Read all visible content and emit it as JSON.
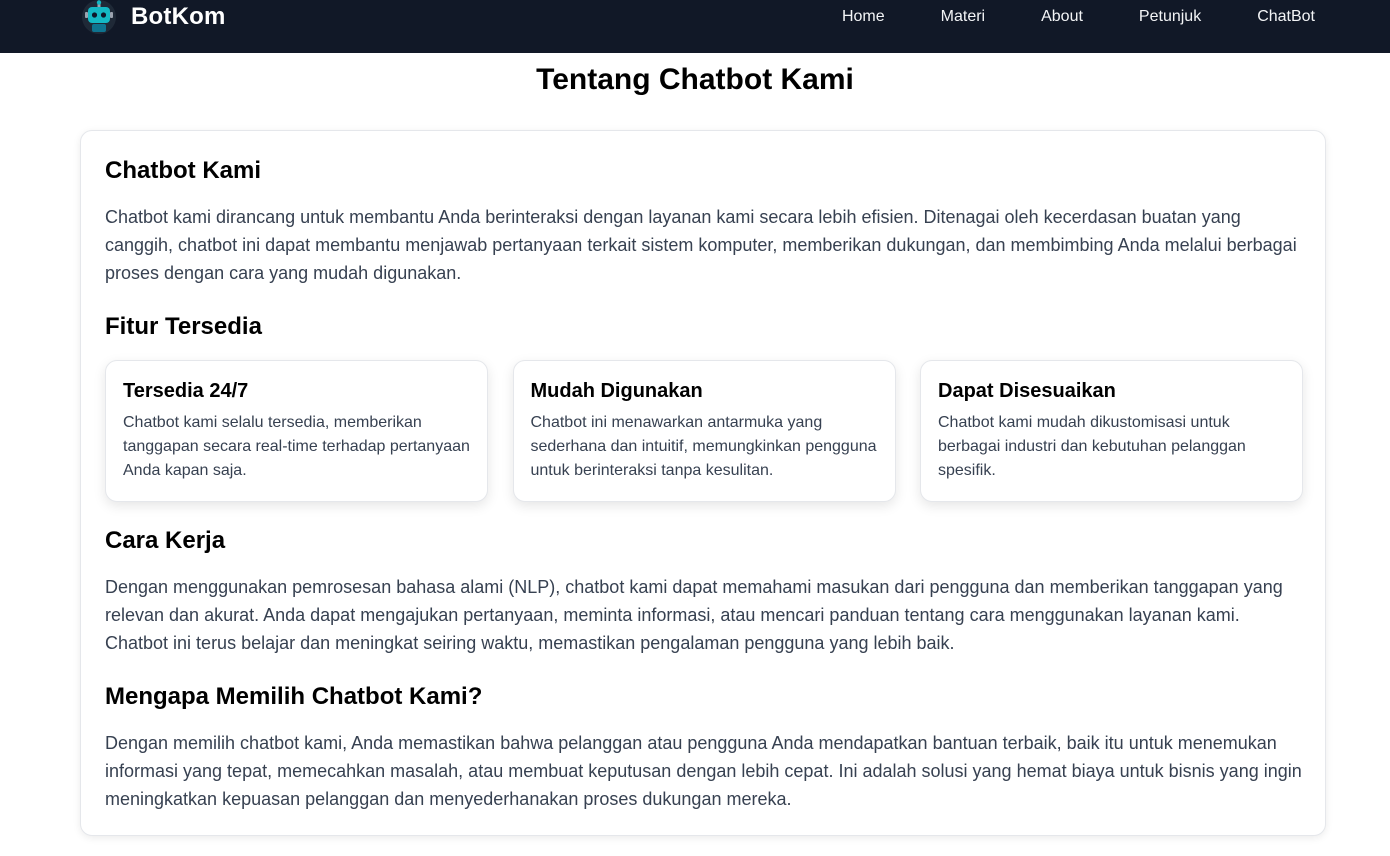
{
  "nav": {
    "brand": "BotKom",
    "links": [
      "Home",
      "Materi",
      "About",
      "Petunjuk",
      "ChatBot"
    ]
  },
  "page": {
    "title": "Tentang Chatbot Kami"
  },
  "sections": {
    "about": {
      "heading": "Chatbot Kami",
      "text": "Chatbot kami dirancang untuk membantu Anda berinteraksi dengan layanan kami secara lebih efisien. Ditenagai oleh kecerdasan buatan yang canggih, chatbot ini dapat membantu menjawab pertanyaan terkait sistem komputer, memberikan dukungan, dan membimbing Anda melalui berbagai proses dengan cara yang mudah digunakan."
    },
    "features": {
      "heading": "Fitur Tersedia",
      "items": [
        {
          "title": "Tersedia 24/7",
          "desc": "Chatbot kami selalu tersedia, memberikan tanggapan secara real-time terhadap pertanyaan Anda kapan saja."
        },
        {
          "title": "Mudah Digunakan",
          "desc": "Chatbot ini menawarkan antarmuka yang sederhana dan intuitif, memungkinkan pengguna untuk berinteraksi tanpa kesulitan."
        },
        {
          "title": "Dapat Disesuaikan",
          "desc": "Chatbot kami mudah dikustomisasi untuk berbagai industri dan kebutuhan pelanggan spesifik."
        }
      ]
    },
    "how": {
      "heading": "Cara Kerja",
      "text": "Dengan menggunakan pemrosesan bahasa alami (NLP), chatbot kami dapat memahami masukan dari pengguna dan memberikan tanggapan yang relevan dan akurat. Anda dapat mengajukan pertanyaan, meminta informasi, atau mencari panduan tentang cara menggunakan layanan kami. Chatbot ini terus belajar dan meningkat seiring waktu, memastikan pengalaman pengguna yang lebih baik."
    },
    "why": {
      "heading": "Mengapa Memilih Chatbot Kami?",
      "text": "Dengan memilih chatbot kami, Anda memastikan bahwa pelanggan atau pengguna Anda mendapatkan bantuan terbaik, baik itu untuk menemukan informasi yang tepat, memecahkan masalah, atau membuat keputusan dengan lebih cepat. Ini adalah solusi yang hemat biaya untuk bisnis yang ingin meningkatkan kepuasan pelanggan dan menyederhanakan proses dukungan mereka."
    }
  },
  "icons": {
    "logo": "robot-icon"
  },
  "colors": {
    "navbar_bg": "#111827",
    "body_text": "#374151",
    "robot_accent": "#14b8c4"
  }
}
